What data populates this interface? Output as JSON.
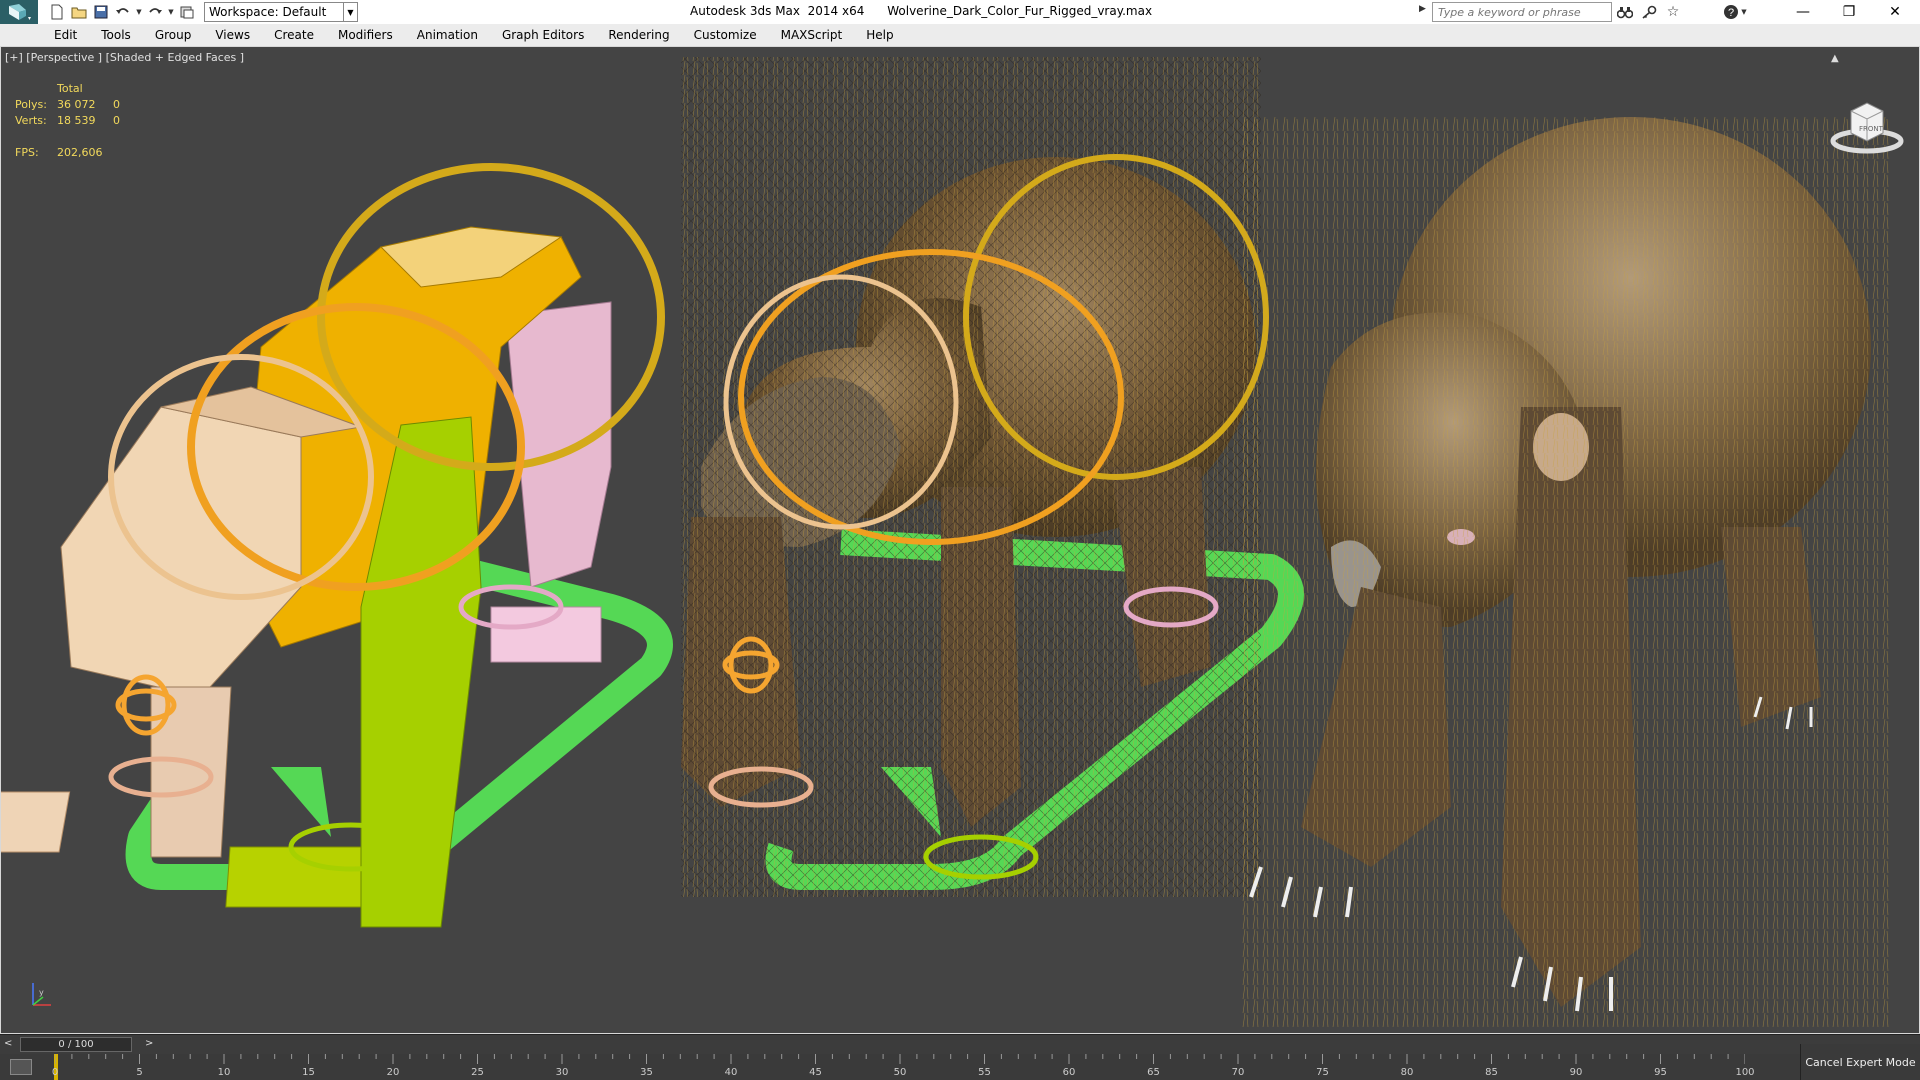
{
  "titlebar": {
    "title": "Autodesk 3ds Max  2014 x64      Wolverine_Dark_Color_Fur_Rigged_vray.max",
    "workspace": "Workspace: Default",
    "search_placeholder": "Type a keyword or phrase",
    "quick_access_icons": [
      "new-file-icon",
      "open-file-icon",
      "save-icon",
      "undo-icon",
      "redo-icon",
      "project-folder-icon"
    ],
    "help_icons": [
      "binoculars-icon",
      "key-icon",
      "star-icon",
      "help-icon"
    ],
    "window_controls": [
      "minimize-icon",
      "restore-icon",
      "close-icon"
    ]
  },
  "menu": {
    "items": [
      "Edit",
      "Tools",
      "Group",
      "Views",
      "Create",
      "Modifiers",
      "Animation",
      "Graph Editors",
      "Rendering",
      "Customize",
      "MAXScript",
      "Help"
    ]
  },
  "viewport": {
    "label": "[+] [Perspective ] [Shaded + Edged Faces ]",
    "stats": {
      "header": "Total",
      "polys_label": "Polys:",
      "polys_value": "36 072",
      "polys_selected": "0",
      "verts_label": "Verts:",
      "verts_value": "18 539",
      "verts_selected": "0",
      "fps_label": "FPS:",
      "fps_value": "202,606"
    },
    "viewcube_face": "FRONT",
    "colors": {
      "background": "#444444",
      "stats_text": "#f2d95c",
      "rig_green": "#55d855",
      "rig_orange": "#f0a020",
      "rig_yellow": "#e0b020"
    }
  },
  "timeline": {
    "slider_label": "0 / 100",
    "prev_label": "<",
    "next_label": ">",
    "current_frame": 0,
    "ticks": [
      "0",
      "5",
      "10",
      "15",
      "20",
      "25",
      "30",
      "35",
      "40",
      "45",
      "50",
      "55",
      "60",
      "65",
      "70",
      "75",
      "80",
      "85",
      "90",
      "95",
      "100"
    ]
  },
  "expert_mode": {
    "label": "Cancel Expert Mode"
  }
}
